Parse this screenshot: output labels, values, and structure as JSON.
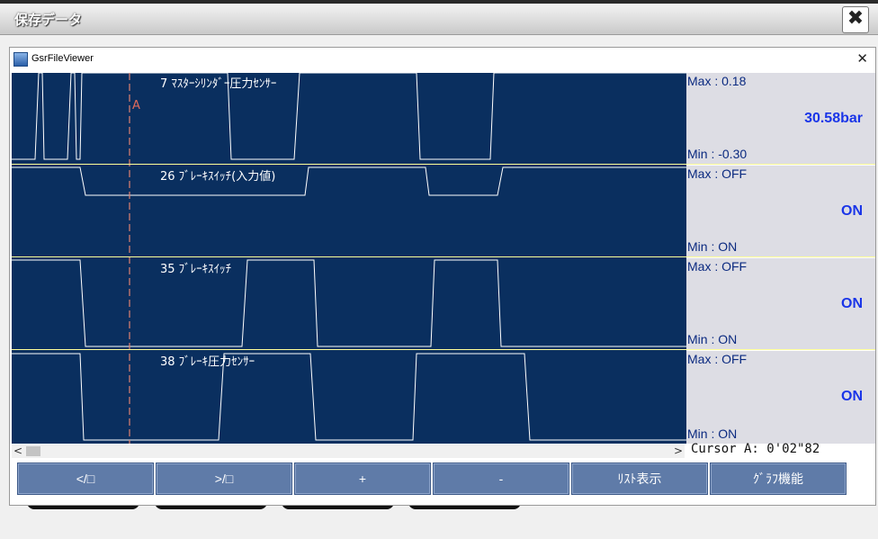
{
  "outer_window": {
    "title": "保存データ",
    "close_glyph": "✖"
  },
  "viewer": {
    "title": "GsrFileViewer",
    "close_glyph": "✕",
    "cursor_marker": "A",
    "channels": [
      {
        "label": "7 ﾏｽﾀｰｼﾘﾝﾀﾞｰ圧力ｾﾝｻｰ",
        "max": "Max :  0.18",
        "min": "Min : -0.30",
        "current": "30.58bar"
      },
      {
        "label": "26 ﾌﾞﾚｰｷｽｲｯﾁ(入力値)",
        "max": "Max : OFF",
        "min": "Min : ON",
        "current": "ON"
      },
      {
        "label": "35 ﾌﾞﾚｰｷｽｲｯﾁ",
        "max": "Max : OFF",
        "min": "Min : ON",
        "current": "ON"
      },
      {
        "label": "38 ﾌﾞﾚｰｷ圧力ｾﾝｻｰ",
        "max": "Max : OFF",
        "min": "Min : ON",
        "current": "ON"
      }
    ],
    "scroll": {
      "left_glyph": "<",
      "right_glyph": ">"
    },
    "cursor_readout": "Cursor A: 0'02\"82",
    "buttons": [
      "</□",
      ">/□",
      "+",
      "-",
      "ﾘｽﾄ表示",
      "ｸﾞﾗﾌ機能"
    ]
  },
  "colors": {
    "plot_bg": "#0a2f5f",
    "trace": "#ffffff",
    "separator": "#ffff99",
    "cursor_line": "#e08070",
    "value_blue": "#1a35e8",
    "button": "#5f7ba8"
  }
}
